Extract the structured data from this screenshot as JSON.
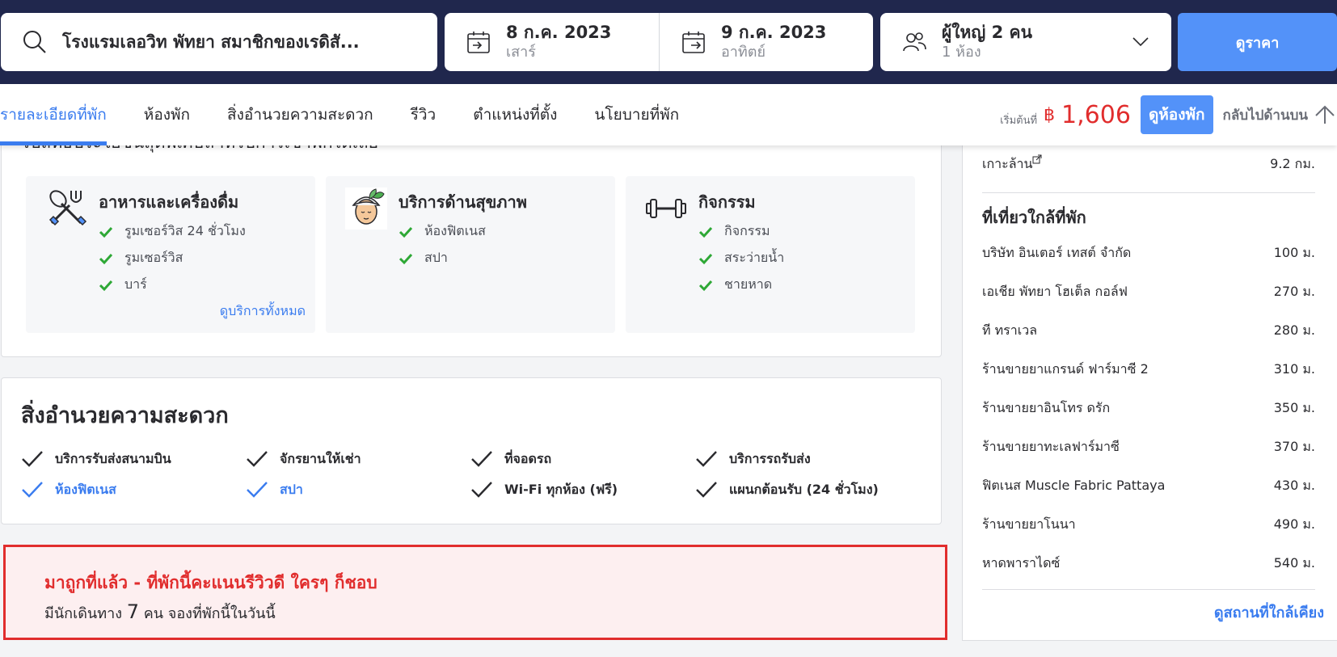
{
  "search": {
    "query": "โรงแรมเลอวิท พัทยา สมาชิกของเรดิสั...",
    "checkin": {
      "date": "8 ก.ค. 2023",
      "day": "เสาร์"
    },
    "checkout": {
      "date": "9 ก.ค. 2023",
      "day": "อาทิตย์"
    },
    "guests": {
      "adults": "ผู้ใหญ่ 2 คน",
      "rooms": "1 ห้อง"
    },
    "button": "ดูราคา"
  },
  "nav": {
    "tabs": [
      "รายละเอียดที่พัก",
      "ห้องพัก",
      "สิ่งอำนวยความสะดวก",
      "รีวิว",
      "ตำแหน่งที่ตั้ง",
      "นโยบายที่พัก"
    ],
    "from_label": "เริ่มต้นที่",
    "currency": "฿",
    "price": "1,606",
    "view_rooms": "ดูห้องพัก",
    "back_top": "กลับไปด้านบน"
  },
  "highlights": {
    "clipped_heading": "รับสิทธิประโยชน์สุดพิเศษสำหรับการเข้าพักได้เลย",
    "cards": [
      {
        "icon": "fork-knife-icon",
        "title": "อาหารและเครื่องดื่ม",
        "items": [
          "รูมเซอร์วิส 24 ชั่วโมง",
          "รูมเซอร์วิส",
          "บาร์"
        ],
        "link": "ดูบริการทั้งหมด"
      },
      {
        "icon": "spa-face-icon",
        "title": "บริการด้านสุขภาพ",
        "items": [
          "ห้องฟิตเนส",
          "สปา"
        ]
      },
      {
        "icon": "dumbbell-icon",
        "title": "กิจกรรม",
        "items": [
          "กิจกรรม",
          "สระว่ายน้ำ",
          "ชายหาด"
        ]
      }
    ]
  },
  "facilities": {
    "title": "สิ่งอำนวยความสะดวก",
    "items": [
      {
        "label": "บริการรับส่งสนามบิน",
        "highlight": false
      },
      {
        "label": "จักรยานให้เช่า",
        "highlight": false
      },
      {
        "label": "ที่จอดรถ",
        "highlight": false
      },
      {
        "label": "บริการรถรับส่ง",
        "highlight": false
      },
      {
        "label": "ห้องฟิตเนส",
        "highlight": true
      },
      {
        "label": "สปา",
        "highlight": true
      },
      {
        "label": "Wi-Fi ทุกห้อง (ฟรี)",
        "highlight": false
      },
      {
        "label": "แผนกต้อนรับ (24 ชั่วโมง)",
        "highlight": false
      }
    ]
  },
  "alert": {
    "title": "มาถูกที่แล้ว - ที่พักนี้คะแนนรีวิวดี ใครๆ ก็ชอบ",
    "sub_prefix": "มีนักเดินทาง",
    "count": "7",
    "sub_suffix": "คน จองที่พักนี้ในวันนี้"
  },
  "sidebar": {
    "top_place": {
      "name": "เกาะล้าน",
      "distance": "9.2 กม."
    },
    "nearby_title": "ที่เที่ยวใกล้ที่พัก",
    "places": [
      {
        "name": "บริษัท อินเตอร์ เทสต์ จำกัด",
        "distance": "100 ม."
      },
      {
        "name": "เอเชีย พัทยา โฮเต็ล กอล์ฟ",
        "distance": "270 ม."
      },
      {
        "name": "ที ทราเวล",
        "distance": "280 ม."
      },
      {
        "name": "ร้านขายยาแกรนด์ ฟาร์มาซี 2",
        "distance": "310 ม."
      },
      {
        "name": "ร้านขายยาอินโทร ดรัก",
        "distance": "350 ม."
      },
      {
        "name": "ร้านขายยาทะเลฟาร์มาซี",
        "distance": "370 ม."
      },
      {
        "name": "ฟิตเนส Muscle Fabric Pattaya",
        "distance": "430 ม."
      },
      {
        "name": "ร้านขายยาโนนา",
        "distance": "490 ม."
      },
      {
        "name": "หาดพาราไดซ์",
        "distance": "540 ม."
      }
    ],
    "link": "ดูสถานที่ใกล้เคียง"
  },
  "colors": {
    "navy": "#20274d",
    "blue": "#5392f9",
    "link": "#3a7cef",
    "red": "#e12d2d",
    "green": "#2ea836"
  }
}
